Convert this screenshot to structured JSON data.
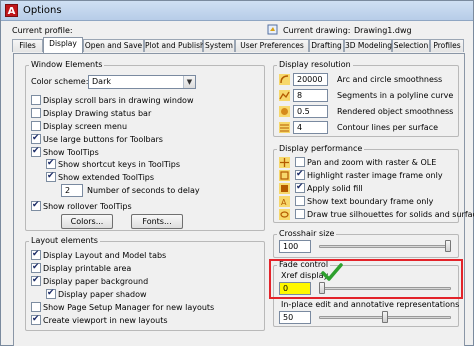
{
  "window": {
    "title": "Options"
  },
  "header": {
    "current_profile_label": "Current profile:",
    "current_drawing_label": "Current drawing:",
    "current_drawing_value": "Drawing1.dwg"
  },
  "tabs": [
    {
      "label": "Files"
    },
    {
      "label": "Display",
      "active": true
    },
    {
      "label": "Open and Save"
    },
    {
      "label": "Plot and Publish"
    },
    {
      "label": "System"
    },
    {
      "label": "User Preferences"
    },
    {
      "label": "Drafting"
    },
    {
      "label": "3D Modeling"
    },
    {
      "label": "Selection"
    },
    {
      "label": "Profiles"
    }
  ],
  "window_elements": {
    "title": "Window Elements",
    "color_scheme_label": "Color scheme:",
    "color_scheme_value": "Dark",
    "items": [
      {
        "label": "Display scroll bars in drawing window",
        "checked": false
      },
      {
        "label": "Display Drawing status bar",
        "checked": false
      },
      {
        "label": "Display screen menu",
        "checked": false
      },
      {
        "label": "Use large buttons for Toolbars",
        "checked": true
      },
      {
        "label": "Show ToolTips",
        "checked": true
      },
      {
        "label": "Show shortcut keys in ToolTips",
        "checked": true
      },
      {
        "label": "Show extended ToolTips",
        "checked": true
      }
    ],
    "delay_value": "2",
    "delay_label": "Number of seconds to delay",
    "rollover_label": "Show rollover ToolTips",
    "rollover_checked": true,
    "colors_button": "Colors...",
    "fonts_button": "Fonts..."
  },
  "layout_elements": {
    "title": "Layout elements",
    "items": [
      {
        "label": "Display Layout and Model tabs",
        "checked": true
      },
      {
        "label": "Display printable area",
        "checked": true
      },
      {
        "label": "Display paper background",
        "checked": true
      },
      {
        "label": "Display paper shadow",
        "checked": true
      },
      {
        "label": "Show Page Setup Manager for new layouts",
        "checked": false
      },
      {
        "label": "Create viewport in new layouts",
        "checked": true
      }
    ]
  },
  "display_resolution": {
    "title": "Display resolution",
    "items": [
      {
        "value": "20000",
        "label": "Arc and circle smoothness"
      },
      {
        "value": "8",
        "label": "Segments in a polyline curve"
      },
      {
        "value": "0.5",
        "label": "Rendered object smoothness"
      },
      {
        "value": "4",
        "label": "Contour lines per surface"
      }
    ]
  },
  "display_performance": {
    "title": "Display performance",
    "items": [
      {
        "label": "Pan and zoom with raster & OLE",
        "checked": false
      },
      {
        "label": "Highlight raster image frame only",
        "checked": true
      },
      {
        "label": "Apply solid fill",
        "checked": true
      },
      {
        "label": "Show text boundary frame only",
        "checked": false
      },
      {
        "label": "Draw true silhouettes for solids and surfaces",
        "checked": false
      }
    ]
  },
  "crosshair": {
    "title": "Crosshair size",
    "value": "100",
    "level": 1.0
  },
  "fade_control": {
    "title": "Fade control",
    "xref_label": "Xref display",
    "xref_value": "0",
    "xref_level": 0.0,
    "inplace_label": "In-place edit and annotative representations",
    "inplace_value": "50",
    "inplace_level": 0.5
  },
  "colors": {
    "checkmark": "#2ea02e",
    "highlight_box": "#e3232a",
    "highlight_fill": "#fff800"
  }
}
